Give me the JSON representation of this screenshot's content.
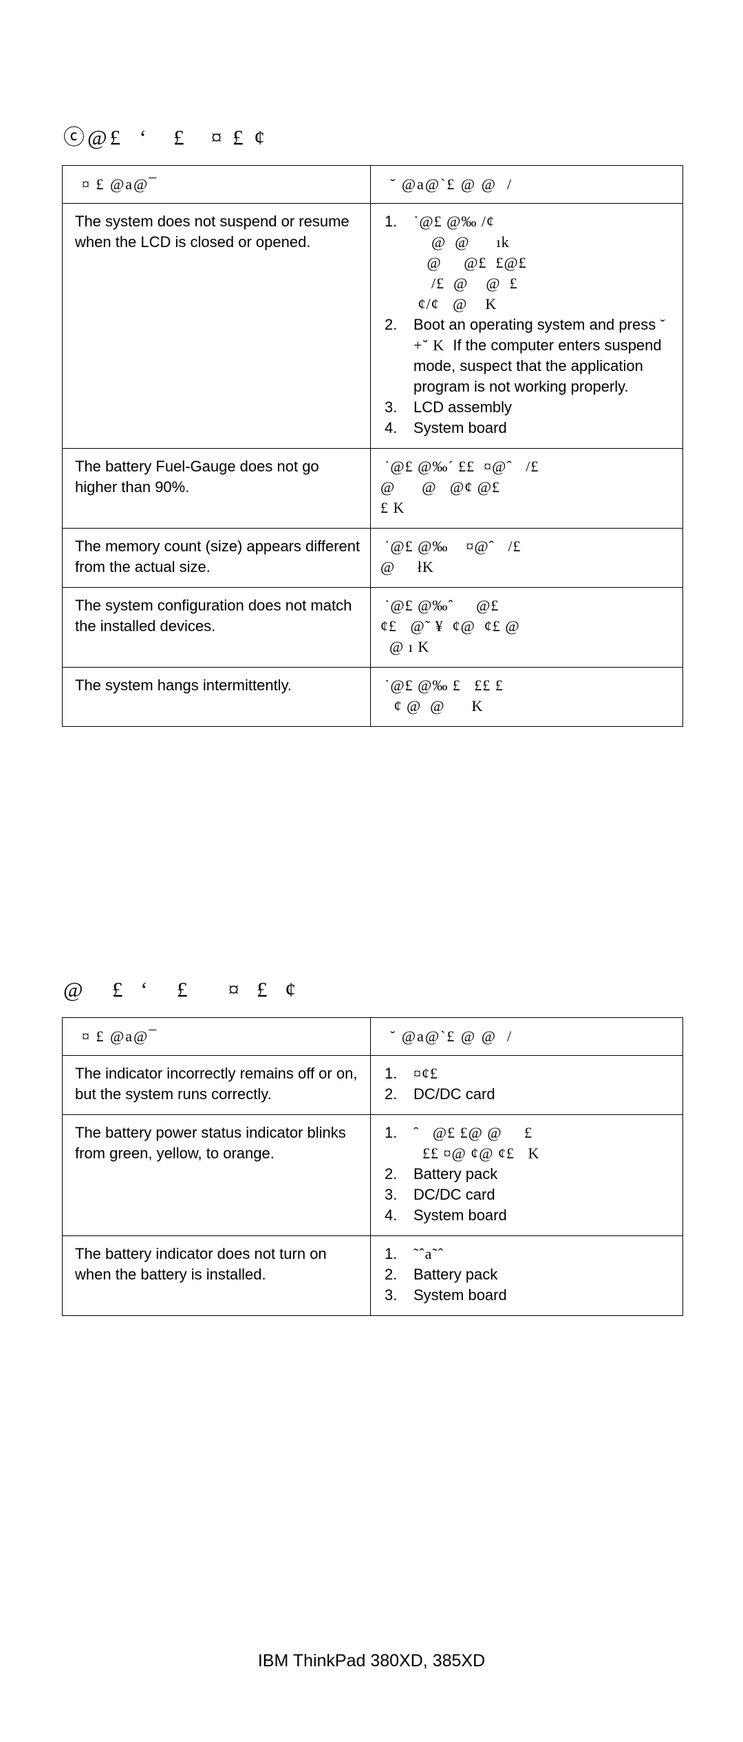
{
  "document": {
    "footer": "IBM ThinkPad 380XD, 385XD"
  },
  "sections": [
    {
      "id": "section-1",
      "heading": "ⓒ@£  ‘   £   ¤ £ ¢",
      "table": {
        "headers": {
          "symptom": "¤ £ @a@¯",
          "action": "˘ @a@`£ @ @  /"
        },
        "rows": [
          {
            "symptom": "The system does not suspend or resume when the LCD is closed or opened.",
            "steps": [
              {
                "num": "1.",
                "kind": "jp",
                "text": "˙@£ @‰ /¢\n    @  @      ık\n   @     @£  £@£\n    /£  @    @  £\n ¢/¢   @    K"
              },
              {
                "num": "2.",
                "kind": "mixed",
                "pre": "Boot an operating system and press ",
                "jp": "˘   +˘ K",
                "post": "  If the computer enters suspend mode, suspect that the application program is not working properly."
              },
              {
                "num": "3.",
                "kind": "en",
                "text": "LCD assembly"
              },
              {
                "num": "4.",
                "kind": "en",
                "text": "System board"
              }
            ]
          },
          {
            "symptom": "The battery Fuel-Gauge does not go higher than 90%.",
            "para": "˙@£ @‰´ ££  ¤@ˆ   /£\n@      @   @¢ @£\n£ K"
          },
          {
            "symptom": "The memory count (size) appears different from the actual size.",
            "para": "˙@£ @‰    ¤@ˆ   /£\n@     łK"
          },
          {
            "symptom": "The system configuration does not match the installed devices.",
            "para": "˙@£ @‰ˆ     @£\n¢£   @˜ ¥  ¢@  ¢£ @\n  @ ı K"
          },
          {
            "symptom": "The system hangs intermittently.",
            "para": "˙@£ @‰ £   ££ £\n   ¢ @  @      K"
          }
        ]
      }
    },
    {
      "id": "section-2",
      "heading": "@  £ ‘  £   ¤ £ ¢",
      "table": {
        "headers": {
          "symptom": "¤ £ @a@¯",
          "action": "˘ @a@`£ @ @  /"
        },
        "rows": [
          {
            "symptom": "The indicator incorrectly remains off or on, but the system runs correctly.",
            "steps": [
              {
                "num": "1.",
                "kind": "jp",
                "text": "¤¢£"
              },
              {
                "num": "2.",
                "kind": "en",
                "text": "DC/DC card"
              }
            ]
          },
          {
            "symptom": "The battery power status indicator blinks from green, yellow, to orange.",
            "steps": [
              {
                "num": "1.",
                "kind": "jp",
                "text": "ˆ   @£ £@ @     £\n  ££ ¤@ ¢@ ¢£   K"
              },
              {
                "num": "2.",
                "kind": "en",
                "text": "Battery pack"
              },
              {
                "num": "3.",
                "kind": "en",
                "text": "DC/DC card"
              },
              {
                "num": "4.",
                "kind": "en",
                "text": "System board"
              }
            ]
          },
          {
            "symptom": "The battery indicator does not turn on when the battery is installed.",
            "steps": [
              {
                "num": "1.",
                "kind": "jp",
                "text": "˜ˆa˜ˆ"
              },
              {
                "num": "2.",
                "kind": "en",
                "text": "Battery pack"
              },
              {
                "num": "3.",
                "kind": "en",
                "text": "System board"
              }
            ]
          }
        ]
      }
    }
  ]
}
